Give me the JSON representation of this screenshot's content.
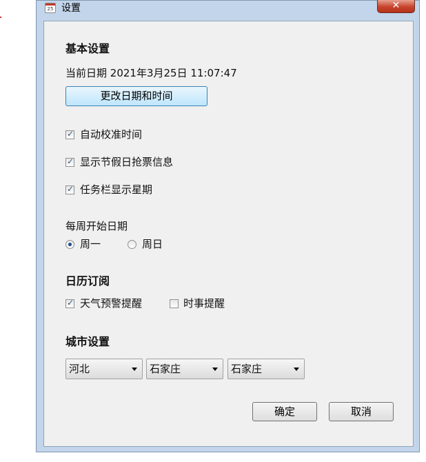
{
  "window": {
    "title": "设置",
    "icon_text": "25",
    "close_symbol": "✕"
  },
  "basic": {
    "heading": "基本设置",
    "date_prefix": "当前日期",
    "current_datetime": "2021年3月25日 11:07:47",
    "change_button": "更改日期和时间"
  },
  "options": [
    {
      "label": "自动校准时间",
      "checked": true
    },
    {
      "label": "显示节假日抢票信息",
      "checked": true
    },
    {
      "label": "任务栏显示星期",
      "checked": true
    }
  ],
  "week_start": {
    "label": "每周开始日期",
    "options": [
      {
        "label": "周一",
        "selected": true
      },
      {
        "label": "周日",
        "selected": false
      }
    ]
  },
  "subscription": {
    "heading": "日历订阅",
    "items": [
      {
        "label": "天气预警提醒",
        "checked": true
      },
      {
        "label": "时事提醒",
        "checked": false
      }
    ]
  },
  "city": {
    "heading": "城市设置",
    "province": "河北",
    "city": "石家庄",
    "district": "石家庄"
  },
  "footer": {
    "ok": "确定",
    "cancel": "取消"
  },
  "colors": {
    "frame": "#c3d5ea",
    "client_bg": "#f0f0f0",
    "close_button": "#c7432b",
    "primary_button": "#bee6fd"
  }
}
